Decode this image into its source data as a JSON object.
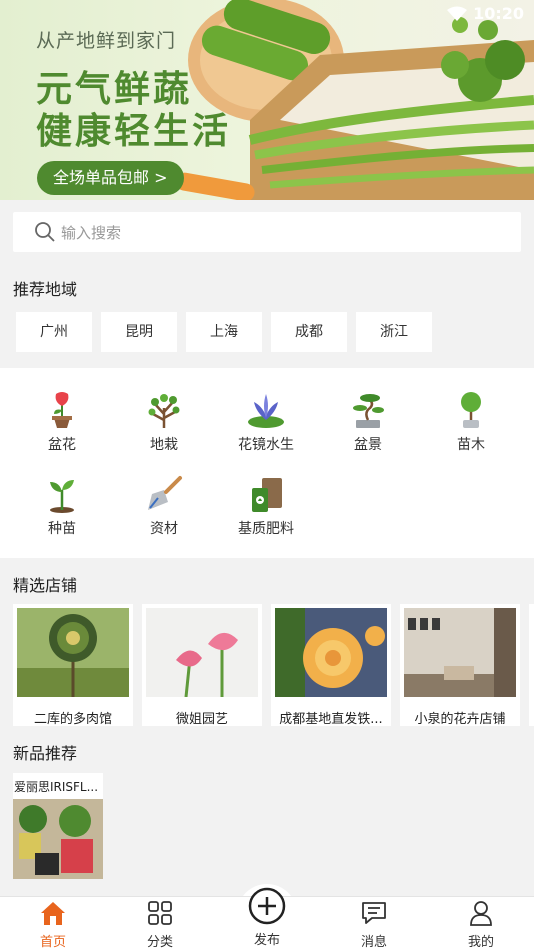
{
  "status_bar": {
    "time": "10:20"
  },
  "banner": {
    "subtitle": "从产地鲜到家门",
    "title_line1": "元气鲜蔬",
    "title_line2": "健康轻生活",
    "button_label": "全场单品包邮 >"
  },
  "search": {
    "placeholder": "输入搜索"
  },
  "regions": {
    "title": "推荐地域",
    "items": [
      "广州",
      "昆明",
      "上海",
      "成都",
      "浙江"
    ]
  },
  "categories": {
    "items": [
      {
        "label": "盆花",
        "icon": "potted-flower-icon"
      },
      {
        "label": "地栽",
        "icon": "tree-icon"
      },
      {
        "label": "花镜水生",
        "icon": "water-lily-icon"
      },
      {
        "label": "盆景",
        "icon": "bonsai-icon"
      },
      {
        "label": "苗木",
        "icon": "sapling-tree-icon"
      },
      {
        "label": "种苗",
        "icon": "seedling-icon"
      },
      {
        "label": "资材",
        "icon": "trowel-icon"
      },
      {
        "label": "基质肥料",
        "icon": "fertilizer-bag-icon"
      }
    ]
  },
  "shops": {
    "title": "精选店铺",
    "items": [
      {
        "name": "二库的多肉馆"
      },
      {
        "name": "微姐园艺"
      },
      {
        "name": "成都基地直发铁..."
      },
      {
        "name": "小泉的花卉店铺"
      }
    ]
  },
  "new_products": {
    "title": "新品推荐",
    "items": [
      {
        "title": "爱丽思IRISFL..."
      }
    ]
  },
  "bottom_nav": {
    "items": [
      {
        "label": "首页",
        "icon": "home-icon",
        "active": true
      },
      {
        "label": "分类",
        "icon": "grid-icon",
        "active": false
      },
      {
        "label": "发布",
        "icon": "plus-circle-icon",
        "active": false
      },
      {
        "label": "消息",
        "icon": "message-icon",
        "active": false
      },
      {
        "label": "我的",
        "icon": "user-icon",
        "active": false
      }
    ]
  },
  "colors": {
    "accent": "#e8641d",
    "brand_green": "#4f8a2f"
  }
}
